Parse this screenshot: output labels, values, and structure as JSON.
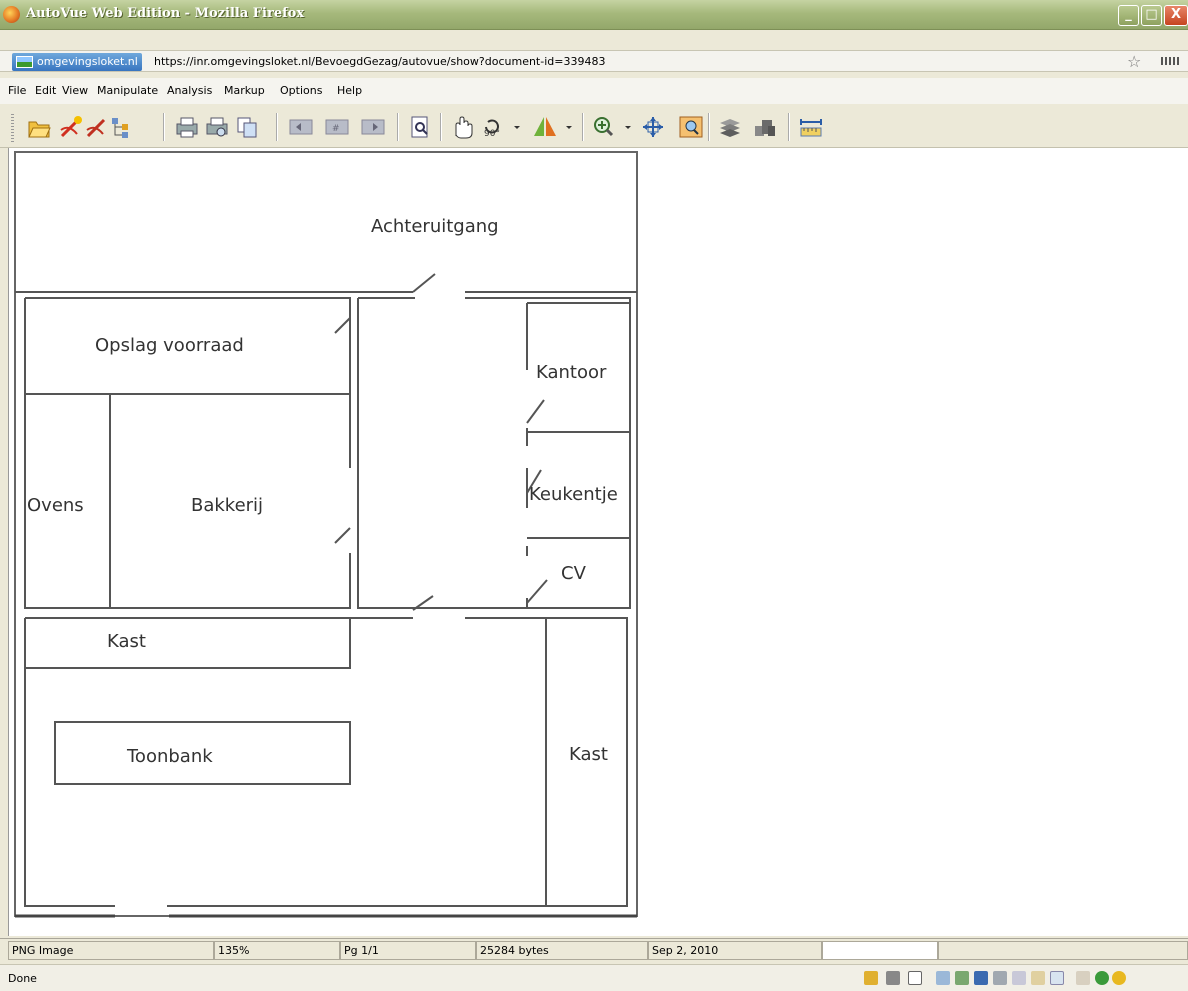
{
  "window": {
    "title": "AutoVue Web Edition - Mozilla Firefox",
    "minimize": "_",
    "maximize": "□",
    "close": "X"
  },
  "address": {
    "site_badge": "omgevingsloket.nl",
    "url": "https://inr.omgevingsloket.nl/BevoegdGezag/autovue/show?document-id=339483"
  },
  "menu": {
    "items": [
      "File",
      "Edit",
      "View",
      "Manipulate",
      "Analysis",
      "Markup",
      "Options",
      "Help"
    ]
  },
  "toolbar": {
    "icons": [
      "open-icon",
      "markup-icon",
      "markup-edit-icon",
      "tree-icon",
      "print-icon",
      "print-preview-icon",
      "copy-icon",
      "prev-page-icon",
      "page-icon",
      "next-page-icon",
      "find-icon",
      "pan-icon",
      "rotate-90-icon",
      "mirror-icon",
      "zoom-icon",
      "fit-icon",
      "zoom-window-icon",
      "layers-icon",
      "blocks-icon",
      "measure-icon"
    ],
    "rotate_label": "90°"
  },
  "floorplan": {
    "rooms": {
      "achteruitgang": "Achteruitgang",
      "opslag": "Opslag voorraad",
      "kantoor": "Kantoor",
      "ovens": "Ovens",
      "bakkerij": "Bakkerij",
      "keukentje": "Keukentje",
      "cv": "CV",
      "kast1": "Kast",
      "toonbank": "Toonbank",
      "kast2": "Kast"
    }
  },
  "status": {
    "type": "PNG Image",
    "zoom": "135%",
    "page": "Pg 1/1",
    "size": "25284 bytes",
    "date": "Sep 2, 2010",
    "done": "Done"
  }
}
